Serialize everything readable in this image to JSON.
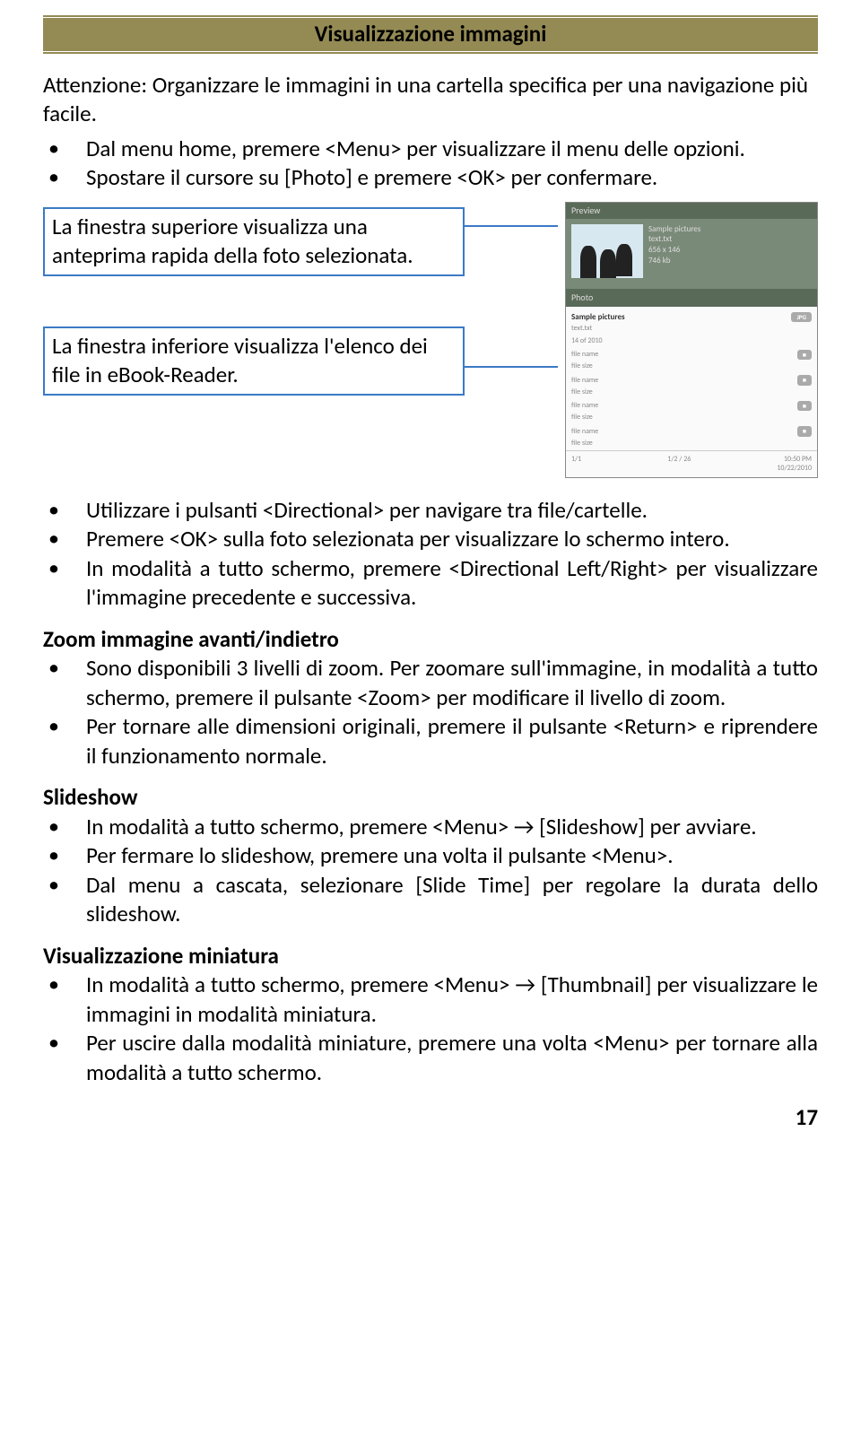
{
  "title": "Visualizzazione immagini",
  "intro": "Attenzione: Organizzare le immagini in una cartella specifica per una navigazione più facile.",
  "topBullets": [
    "Dal menu home, premere <Menu> per visualizzare il menu delle opzioni.",
    "Spostare il cursore su [Photo] e premere <OK> per confermare."
  ],
  "callout1": "La finestra superiore visualizza una anteprima rapida della foto selezionata.",
  "callout2": "La finestra inferiore visualizza l'elenco dei file in eBook-Reader.",
  "screenshot": {
    "previewLabel": "Preview",
    "photoLabel": "Photo",
    "metaLine1": "Sample pictures",
    "metaLine2": "text.txt",
    "metaLine3": "656 x 146",
    "metaLine4": "746 kb",
    "folder": "Sample pictures",
    "folderSub1": "text.txt",
    "folderSub2": "14 of 2010",
    "folderBadge": "JPG",
    "fileLabel": "file name",
    "fileSub": "file size",
    "footerLeft": "1/1",
    "footerMid": "1/2 / 26",
    "footerRight": "10:50 PM\n10/22/2010"
  },
  "midBullets": [
    "Utilizzare i pulsanti <Directional> per navigare tra file/cartelle.",
    "Premere <OK> sulla foto selezionata per visualizzare lo schermo intero.",
    "In modalità a tutto schermo, premere <Directional Left/Right> per visualizzare l'immagine precedente e successiva."
  ],
  "zoom": {
    "heading": "Zoom immagine avanti/indietro",
    "items": [
      "Sono disponibili 3 livelli di zoom. Per zoomare sull'immagine, in modalità a tutto schermo, premere il pulsante <Zoom> per modificare il livello di zoom.",
      "Per tornare alle dimensioni originali, premere il pulsante <Return> e riprendere il funzionamento normale."
    ]
  },
  "slideshow": {
    "heading": "Slideshow",
    "items": [
      "In modalità a tutto schermo, premere <Menu> → [Slideshow] per avviare.",
      "Per fermare lo slideshow, premere una volta il pulsante <Menu>.",
      "Dal menu a cascata, selezionare [Slide Time] per regolare la durata dello slideshow."
    ]
  },
  "thumb": {
    "heading": "Visualizzazione miniatura",
    "items": [
      "In modalità a tutto schermo, premere <Menu> → [Thumbnail] per visualizzare le immagini in modalità miniatura.",
      "Per uscire dalla modalità miniature, premere una volta <Menu> per tornare alla modalità a tutto schermo."
    ]
  },
  "pageNumber": "17"
}
